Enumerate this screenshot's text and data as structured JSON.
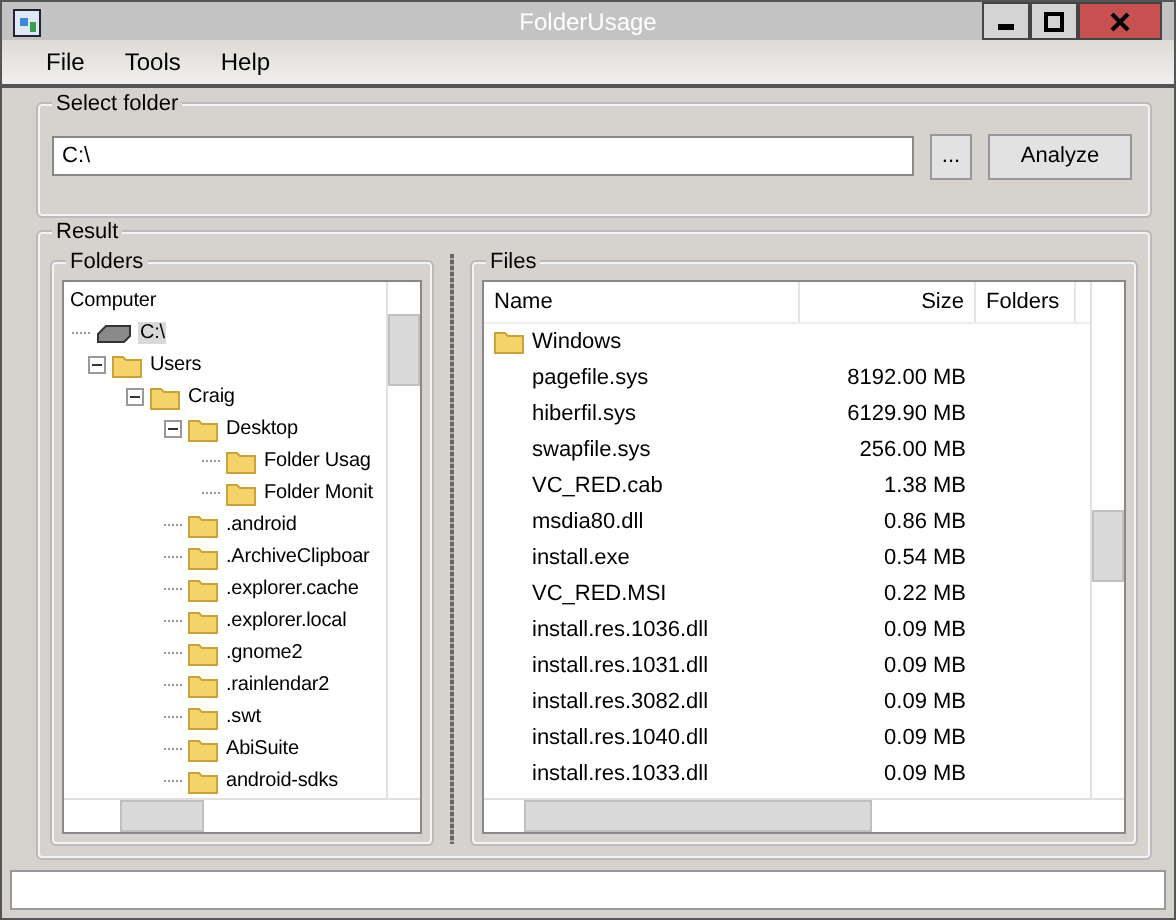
{
  "window": {
    "title": "FolderUsage"
  },
  "menu": [
    "File",
    "Tools",
    "Help"
  ],
  "select_folder": {
    "title": "Select folder",
    "value": "C:\\",
    "browse_button": "...",
    "analyze_button": "Analyze"
  },
  "result": {
    "title": "Result",
    "folders": {
      "title": "Folders",
      "tree": [
        {
          "label": "Computer",
          "kind": "root",
          "selected": false,
          "children": [
            {
              "label": "C:\\",
              "kind": "drive",
              "selected": true,
              "children": [
                {
                  "label": "Users",
                  "kind": "folder",
                  "selected": false,
                  "expanded": true,
                  "children": [
                    {
                      "label": "Craig",
                      "kind": "folder",
                      "selected": false,
                      "expanded": true,
                      "children": [
                        {
                          "label": "Desktop",
                          "kind": "folder",
                          "selected": false,
                          "expanded": true,
                          "children": [
                            {
                              "label": "Folder Usag",
                              "kind": "folder",
                              "selected": false
                            },
                            {
                              "label": "Folder Monit",
                              "kind": "folder",
                              "selected": false
                            }
                          ]
                        },
                        {
                          "label": ".android",
                          "kind": "folder",
                          "selected": false
                        },
                        {
                          "label": ".ArchiveClipboar",
                          "kind": "folder",
                          "selected": false
                        },
                        {
                          "label": ".explorer.cache",
                          "kind": "folder",
                          "selected": false
                        },
                        {
                          "label": ".explorer.local",
                          "kind": "folder",
                          "selected": false
                        },
                        {
                          "label": ".gnome2",
                          "kind": "folder",
                          "selected": false
                        },
                        {
                          "label": ".rainlendar2",
                          "kind": "folder",
                          "selected": false
                        },
                        {
                          "label": ".swt",
                          "kind": "folder",
                          "selected": false
                        },
                        {
                          "label": "AbiSuite",
                          "kind": "folder",
                          "selected": false
                        },
                        {
                          "label": "android-sdks",
                          "kind": "folder",
                          "selected": false
                        }
                      ]
                    }
                  ]
                }
              ]
            }
          ]
        }
      ]
    },
    "files": {
      "title": "Files",
      "columns": [
        "Name",
        "Size",
        "Folders"
      ],
      "rows": [
        {
          "name": "Windows",
          "kind": "folder"
        },
        {
          "name": "pagefile.sys",
          "size": "8192.00 MB",
          "kind": "file"
        },
        {
          "name": "hiberfil.sys",
          "size": "6129.90 MB",
          "kind": "file"
        },
        {
          "name": "swapfile.sys",
          "size": "256.00 MB",
          "kind": "file"
        },
        {
          "name": "VC_RED.cab",
          "size": "1.38 MB",
          "kind": "file"
        },
        {
          "name": "msdia80.dll",
          "size": "0.86 MB",
          "kind": "file"
        },
        {
          "name": "install.exe",
          "size": "0.54 MB",
          "kind": "file"
        },
        {
          "name": "VC_RED.MSI",
          "size": "0.22 MB",
          "kind": "file"
        },
        {
          "name": "install.res.1036.dll",
          "size": "0.09 MB",
          "kind": "file"
        },
        {
          "name": "install.res.1031.dll",
          "size": "0.09 MB",
          "kind": "file"
        },
        {
          "name": "install.res.3082.dll",
          "size": "0.09 MB",
          "kind": "file"
        },
        {
          "name": "install.res.1040.dll",
          "size": "0.09 MB",
          "kind": "file"
        },
        {
          "name": "install.res.1033.dll",
          "size": "0.09 MB",
          "kind": "file"
        }
      ]
    }
  }
}
